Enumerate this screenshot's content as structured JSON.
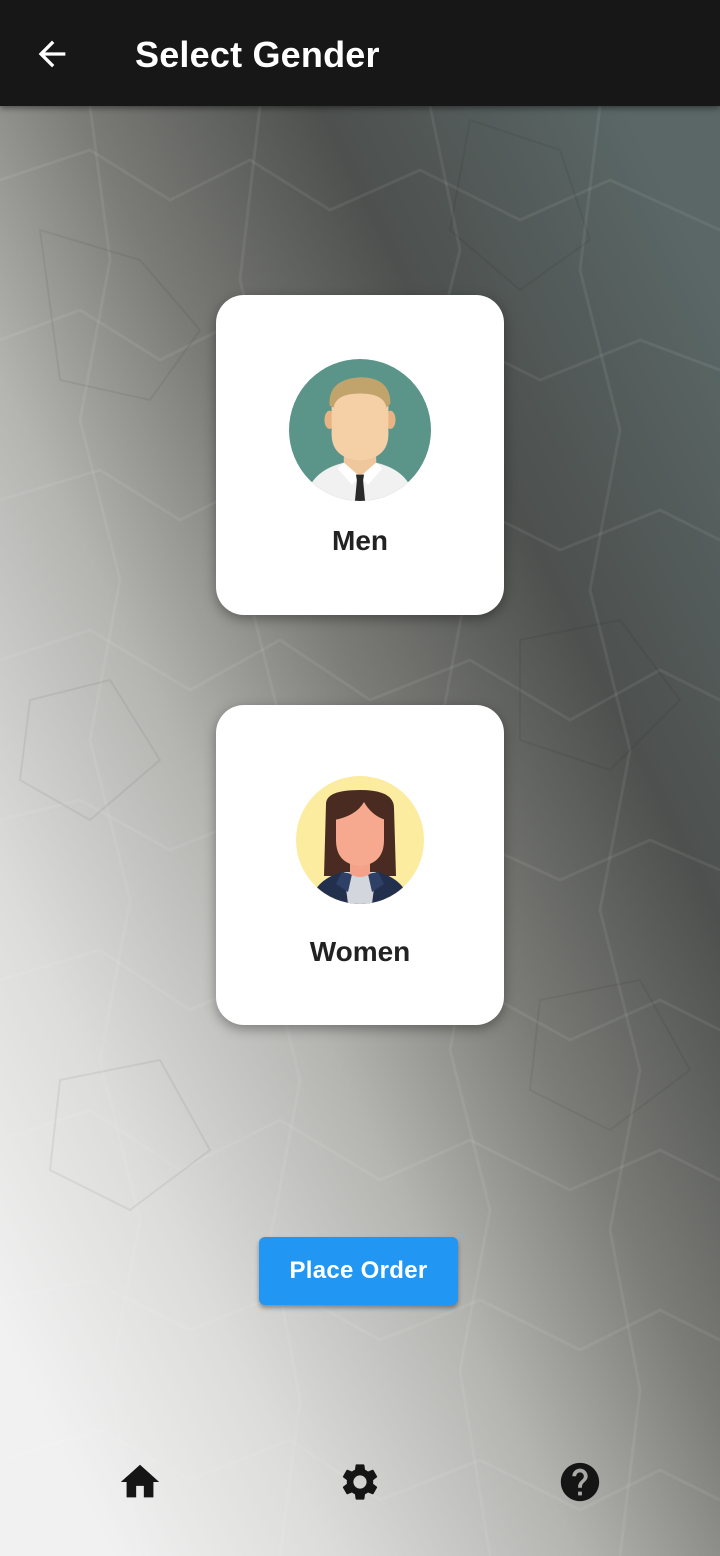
{
  "app_bar": {
    "title": "Select Gender",
    "back_icon": "arrow-back-icon",
    "background": "#171717"
  },
  "options": [
    {
      "label": "Men",
      "icon": "man-avatar-icon",
      "avatar_color": "#5b958a"
    },
    {
      "label": "Women",
      "icon": "woman-avatar-icon",
      "avatar_color": "#fcec9f"
    }
  ],
  "place_order": {
    "label": "Place Order",
    "color": "#2196f3"
  },
  "bottom_nav": [
    {
      "icon": "home-icon"
    },
    {
      "icon": "settings-gear-icon"
    },
    {
      "icon": "help-icon"
    }
  ]
}
